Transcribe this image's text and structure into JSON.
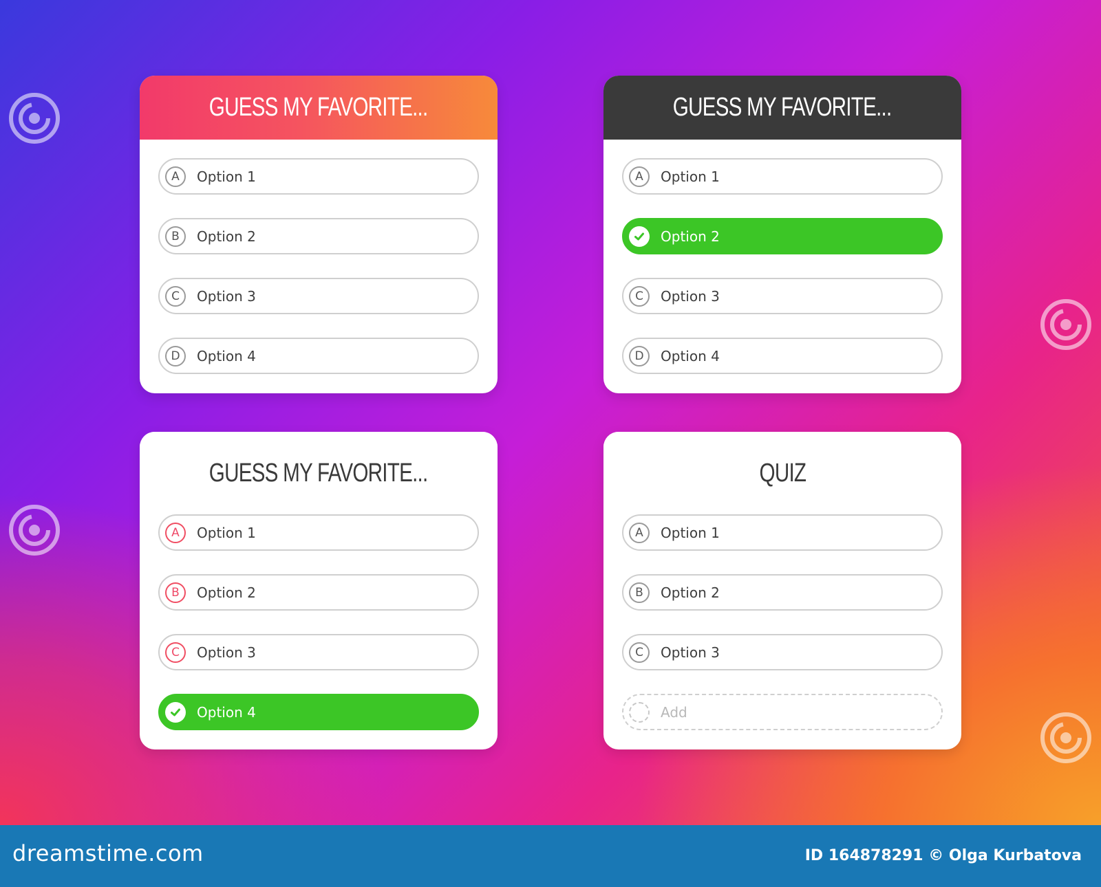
{
  "footer": {
    "logo_text": "dreamstime.com",
    "credit": "ID 164878291 © Olga Kurbatova"
  },
  "colors": {
    "selected_green": "#3cc626",
    "header_gradient_start": "#f23a6a",
    "header_gradient_end": "#f78a3a",
    "header_dark": "#3a3a3a",
    "footer_blue": "#1978b5"
  },
  "cards": [
    {
      "title": "GUESS MY FAVORITE...",
      "header_style": "gradient",
      "options": [
        {
          "letter": "A",
          "label": "Option 1",
          "selected": false
        },
        {
          "letter": "B",
          "label": "Option 2",
          "selected": false
        },
        {
          "letter": "C",
          "label": "Option 3",
          "selected": false
        },
        {
          "letter": "D",
          "label": "Option 4",
          "selected": false
        }
      ]
    },
    {
      "title": "GUESS MY FAVORITE...",
      "header_style": "dark",
      "options": [
        {
          "letter": "A",
          "label": "Option 1",
          "selected": false
        },
        {
          "letter": "B",
          "label": "Option 2",
          "selected": true
        },
        {
          "letter": "C",
          "label": "Option 3",
          "selected": false
        },
        {
          "letter": "D",
          "label": "Option 4",
          "selected": false
        }
      ]
    },
    {
      "title": "GUESS MY FAVORITE...",
      "header_style": "plain",
      "options": [
        {
          "letter": "A",
          "label": "Option 1",
          "selected": false
        },
        {
          "letter": "B",
          "label": "Option 2",
          "selected": false
        },
        {
          "letter": "C",
          "label": "Option 3",
          "selected": false
        },
        {
          "letter": "D",
          "label": "Option 4",
          "selected": true
        }
      ]
    },
    {
      "title": "QUIZ",
      "header_style": "plain",
      "options": [
        {
          "letter": "A",
          "label": "Option 1",
          "selected": false
        },
        {
          "letter": "B",
          "label": "Option 2",
          "selected": false
        },
        {
          "letter": "C",
          "label": "Option 3",
          "selected": false
        }
      ],
      "add_label": "Add"
    }
  ]
}
